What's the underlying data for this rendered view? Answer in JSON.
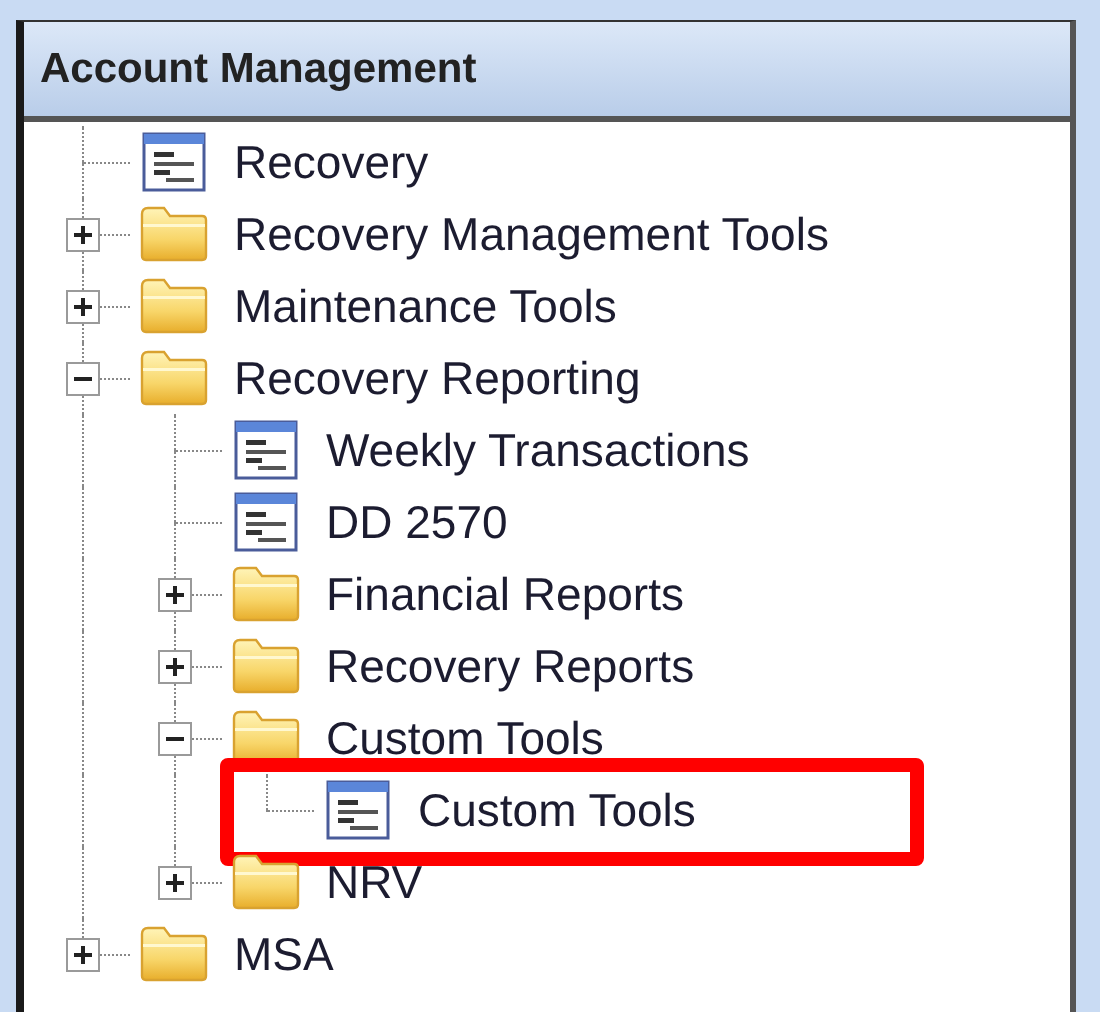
{
  "panel": {
    "title": "Account Management"
  },
  "tree": [
    {
      "label": "Recovery",
      "kind": "form"
    },
    {
      "label": "Recovery Management Tools",
      "kind": "folder",
      "expanded": false
    },
    {
      "label": "Maintenance Tools",
      "kind": "folder",
      "expanded": false
    },
    {
      "label": "Recovery Reporting",
      "kind": "folder",
      "expanded": true,
      "children": [
        {
          "label": "Weekly Transactions",
          "kind": "form"
        },
        {
          "label": "DD 2570",
          "kind": "form"
        },
        {
          "label": "Financial Reports",
          "kind": "folder",
          "expanded": false
        },
        {
          "label": "Recovery Reports",
          "kind": "folder",
          "expanded": false
        },
        {
          "label": "Custom Tools",
          "kind": "folder",
          "expanded": true,
          "children": [
            {
              "label": "Custom Tools",
              "kind": "form",
              "highlighted": true
            }
          ]
        },
        {
          "label": "NRV",
          "kind": "folder",
          "expanded": false
        }
      ]
    },
    {
      "label": "MSA",
      "kind": "folder",
      "expanded": false
    }
  ]
}
